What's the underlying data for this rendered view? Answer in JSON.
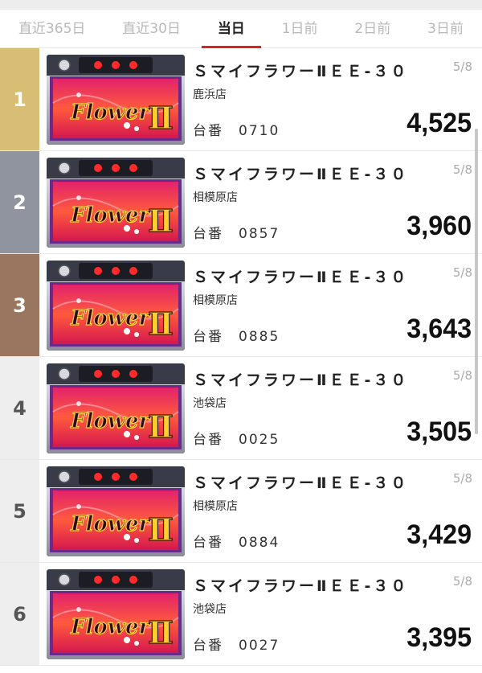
{
  "tabs": [
    {
      "label": "直近365日",
      "active": false
    },
    {
      "label": "直近30日",
      "active": false
    },
    {
      "label": "当日",
      "active": true
    },
    {
      "label": "1日前",
      "active": false
    },
    {
      "label": "2日前",
      "active": false
    },
    {
      "label": "3日前",
      "active": false
    }
  ],
  "machine_label": "台番",
  "rows": [
    {
      "rank": "1",
      "name": "ＳマイフラワーⅡＥＥ-３０",
      "store": "鹿浜店",
      "machine_no": "0710",
      "date": "5/8",
      "value": "4,525"
    },
    {
      "rank": "2",
      "name": "ＳマイフラワーⅡＥＥ-３０",
      "store": "相模原店",
      "machine_no": "0857",
      "date": "5/8",
      "value": "3,960"
    },
    {
      "rank": "3",
      "name": "ＳマイフラワーⅡＥＥ-３０",
      "store": "相模原店",
      "machine_no": "0885",
      "date": "5/8",
      "value": "3,643"
    },
    {
      "rank": "4",
      "name": "ＳマイフラワーⅡＥＥ-３０",
      "store": "池袋店",
      "machine_no": "0025",
      "date": "5/8",
      "value": "3,505"
    },
    {
      "rank": "5",
      "name": "ＳマイフラワーⅡＥＥ-３０",
      "store": "相模原店",
      "machine_no": "0884",
      "date": "5/8",
      "value": "3,429"
    },
    {
      "rank": "6",
      "name": "ＳマイフラワーⅡＥＥ-３０",
      "store": "池袋店",
      "machine_no": "0027",
      "date": "5/8",
      "value": "3,395"
    }
  ],
  "colors": {
    "accent": "#d9261c",
    "gold": "#d7be74",
    "silver": "#8f949e",
    "bronze": "#9a7660"
  }
}
